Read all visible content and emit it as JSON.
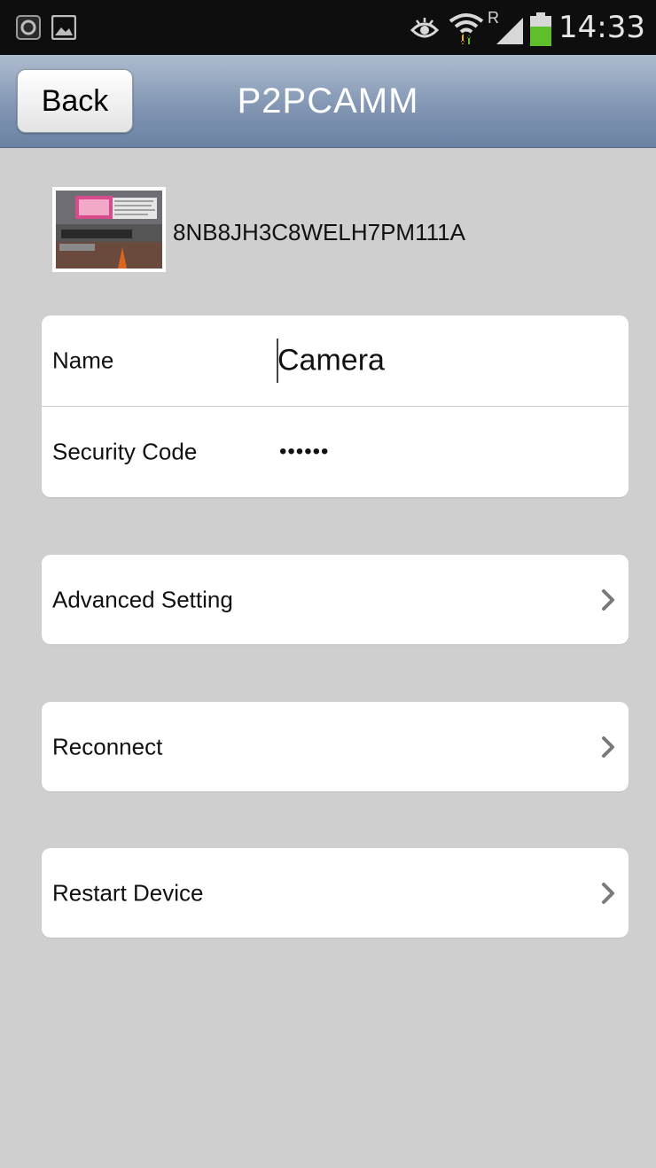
{
  "status_bar": {
    "time": "14:33",
    "icons": [
      "app-notification-icon",
      "image-notification-icon",
      "eye-icon",
      "wifi-icon",
      "roaming-signal-icon",
      "battery-icon"
    ],
    "roaming_letter": "R"
  },
  "header": {
    "back_label": "Back",
    "title": "P2PCAMM"
  },
  "device": {
    "id": "8NB8JH3C8WELH7PM111A"
  },
  "form": {
    "name_label": "Name",
    "name_value": "Camera",
    "security_label": "Security Code",
    "security_value": "••••••"
  },
  "menu": {
    "advanced_label": "Advanced Setting",
    "reconnect_label": "Reconnect",
    "restart_label": "Restart Device"
  },
  "colors": {
    "background": "#cfcfcf",
    "titlebar": "#8397b4",
    "battery": "#5fbf2a"
  }
}
